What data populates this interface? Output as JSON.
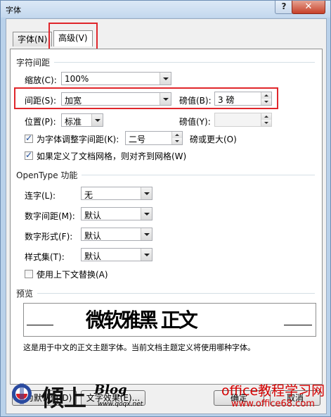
{
  "window": {
    "title": "字体",
    "help": "?",
    "close": "✕"
  },
  "tabs": [
    {
      "label": "字体(N)"
    },
    {
      "label": "高级(V)"
    }
  ],
  "spacing": {
    "section": "字符间距",
    "scale_label": "缩放(C):",
    "scale_value": "100%",
    "spacing_label": "间距(S):",
    "spacing_value": "加宽",
    "spacing_points_label": "磅值(B):",
    "spacing_points_value": "3 磅",
    "position_label": "位置(P):",
    "position_value": "标准",
    "position_points_label": "磅值(Y):",
    "position_points_value": "",
    "kerning_label": "为字体调整字间距(K):",
    "kerning_value": "二号",
    "kerning_suffix": "磅或更大(O)",
    "kerning_checked": true,
    "grid_label": "如果定义了文档网格，则对齐到网格(W)",
    "grid_checked": true
  },
  "opentype": {
    "section": "OpenType 功能",
    "ligatures_label": "连字(L):",
    "ligatures_value": "无",
    "numspacing_label": "数字间距(M):",
    "numspacing_value": "默认",
    "numforms_label": "数字形式(F):",
    "numforms_value": "默认",
    "stylesets_label": "样式集(T):",
    "stylesets_value": "默认",
    "contextual_label": "使用上下文替换(A)",
    "contextual_checked": false
  },
  "preview": {
    "section": "预览",
    "sample": "微软雅黑 正文",
    "note": "这是用于中文的正文主题字体。当前文档主题定义将使用哪种字体。"
  },
  "buttons": {
    "default": "设为默认值(D)",
    "effects": "文字效果(E)...",
    "ok": "确定",
    "cancel": "取消"
  },
  "logo": {
    "text": "傾上",
    "blog": "Blog",
    "url": "www.qoqx.net"
  },
  "watermark": {
    "title": "office教程学习网",
    "url": "www.office68.com"
  },
  "colors": {
    "highlight": "#e0262b",
    "watermark": "#d40000"
  }
}
